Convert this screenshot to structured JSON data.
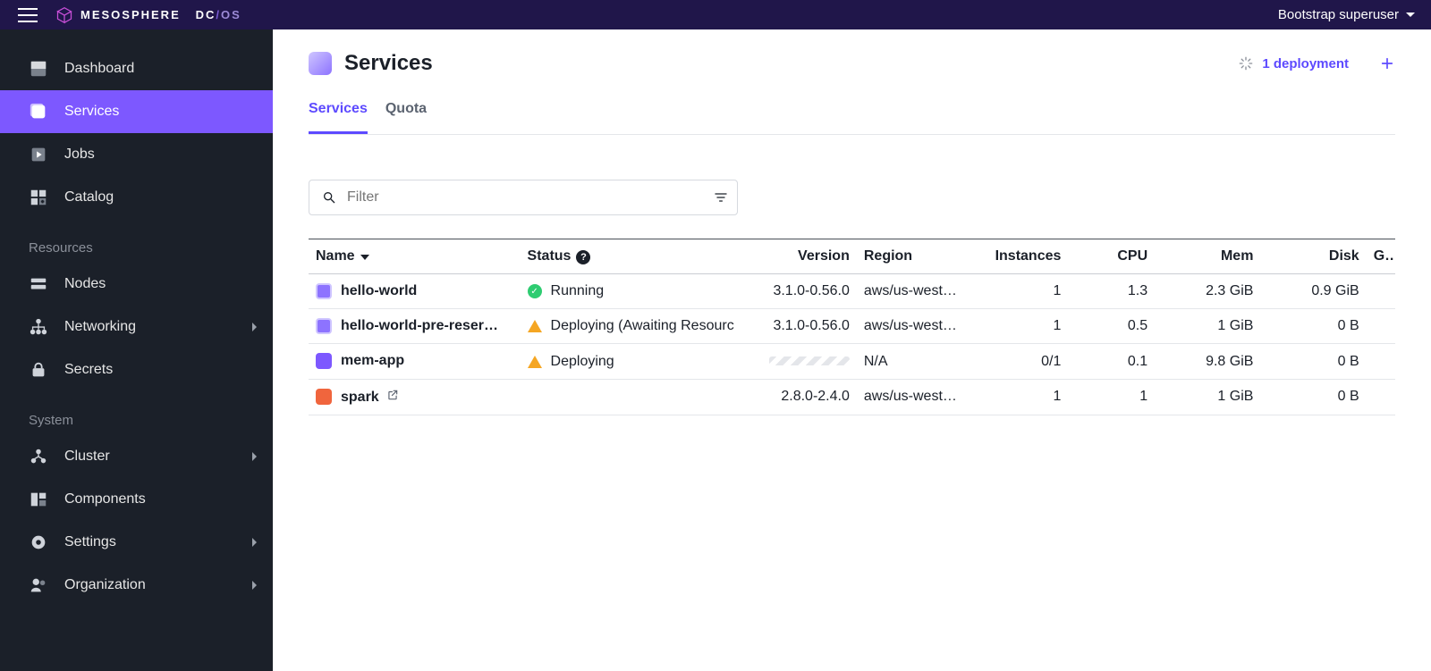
{
  "topbar": {
    "brand_prefix": "MESOSPHERE",
    "brand_dc": "DC",
    "brand_slash": "/",
    "brand_os": "OS",
    "user_label": "Bootstrap superuser"
  },
  "sidebar": {
    "items": [
      {
        "label": "Dashboard"
      },
      {
        "label": "Services"
      },
      {
        "label": "Jobs"
      },
      {
        "label": "Catalog"
      }
    ],
    "section_resources": "Resources",
    "resources": [
      {
        "label": "Nodes"
      },
      {
        "label": "Networking",
        "expandable": true
      },
      {
        "label": "Secrets"
      }
    ],
    "section_system": "System",
    "system": [
      {
        "label": "Cluster",
        "expandable": true
      },
      {
        "label": "Components"
      },
      {
        "label": "Settings",
        "expandable": true
      },
      {
        "label": "Organization",
        "expandable": true
      }
    ]
  },
  "page": {
    "title": "Services",
    "deployments_label": "1 deployment"
  },
  "tabs": {
    "services": "Services",
    "quota": "Quota"
  },
  "filter": {
    "placeholder": "Filter"
  },
  "columns": {
    "name": "Name",
    "status": "Status",
    "version": "Version",
    "region": "Region",
    "instances": "Instances",
    "cpu": "CPU",
    "mem": "Mem",
    "disk": "Disk",
    "gpu": "GP"
  },
  "services": [
    {
      "icon": "purple",
      "name": "hello-world",
      "status_kind": "ok",
      "status": "Running",
      "version": "3.1.0-0.56.0",
      "region": "aws/us-west…",
      "instances": "1",
      "cpu": "1.3",
      "mem": "2.3 GiB",
      "disk": "0.9 GiB"
    },
    {
      "icon": "purple",
      "name": "hello-world-pre-reser…",
      "status_kind": "warn",
      "status": "Deploying (Awaiting Resourc",
      "version": "3.1.0-0.56.0",
      "region": "aws/us-west…",
      "instances": "1",
      "cpu": "0.5",
      "mem": "1 GiB",
      "disk": "0 B"
    },
    {
      "icon": "violet",
      "name": "mem-app",
      "status_kind": "warn",
      "status": "Deploying",
      "version": "",
      "version_placeholder": true,
      "region": "N/A",
      "instances": "0/1",
      "cpu": "0.1",
      "mem": "9.8 GiB",
      "disk": "0 B"
    },
    {
      "icon": "orange",
      "name": "spark",
      "external": true,
      "status_kind": "",
      "status": "",
      "version": "2.8.0-2.4.0",
      "region": "aws/us-west…",
      "instances": "1",
      "cpu": "1",
      "mem": "1 GiB",
      "disk": "0 B"
    }
  ]
}
